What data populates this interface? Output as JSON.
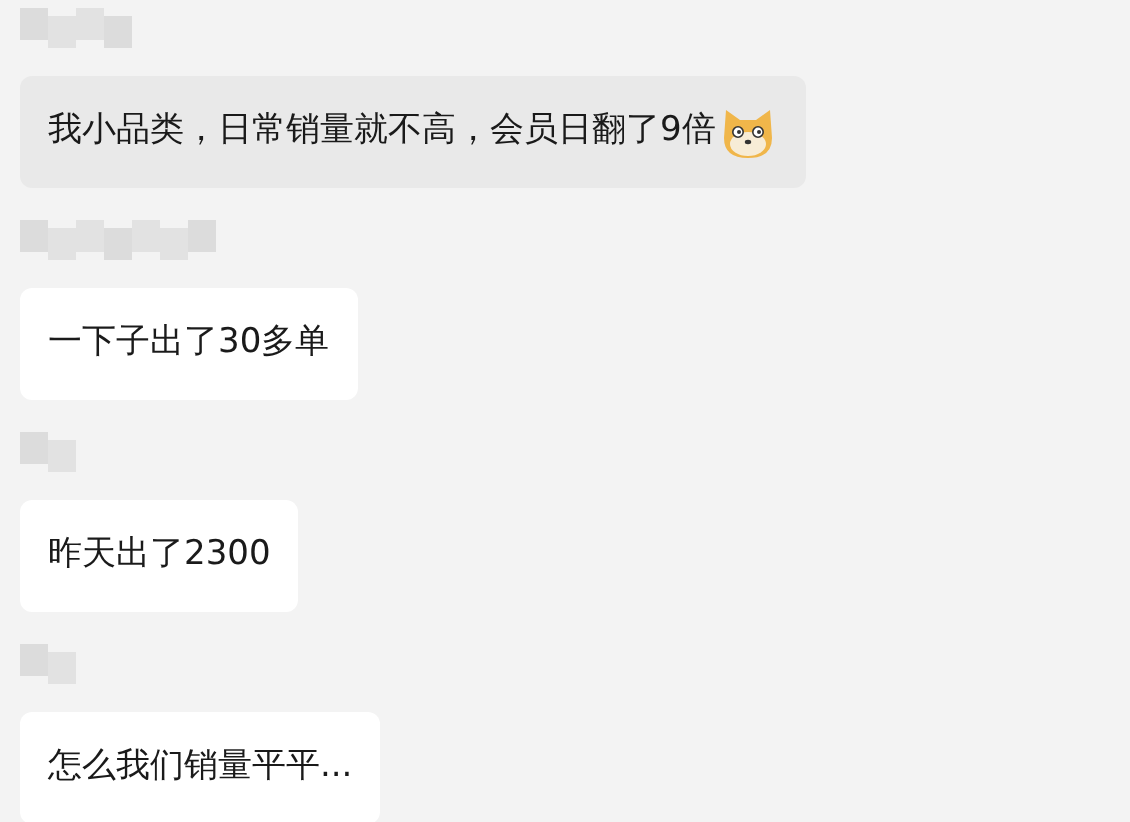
{
  "messages": [
    {
      "text": "我小品类，日常销量就不高，会员日翻了9倍",
      "highlighted": true,
      "sticker": true
    },
    {
      "text": "一下子出了30多单",
      "highlighted": false,
      "sticker": false
    },
    {
      "text": "昨天出了2300",
      "highlighted": false,
      "sticker": false
    },
    {
      "text": "怎么我们销量平平...",
      "highlighted": false,
      "sticker": false
    }
  ]
}
